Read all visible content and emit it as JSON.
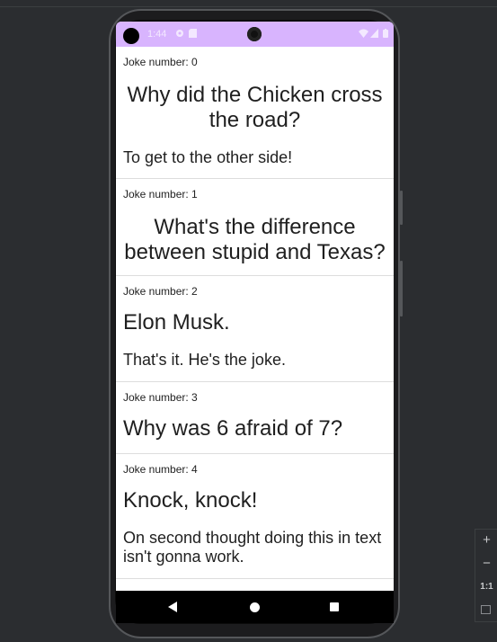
{
  "status_bar": {
    "time": "1:44"
  },
  "jokes": [
    {
      "number_label": "Joke number: 0",
      "question": "Why did the Chicken cross the road?",
      "answer": "To get to the other side!"
    },
    {
      "number_label": "Joke number: 1",
      "question": "What's the difference between stupid and Texas?",
      "answer": ""
    },
    {
      "number_label": "Joke number: 2",
      "question": "Elon Musk.",
      "answer": "That's it. He's the joke."
    },
    {
      "number_label": "Joke number: 3",
      "question": "Why was 6 afraid of 7?",
      "answer": ""
    },
    {
      "number_label": "Joke number: 4",
      "question": "Knock, knock!",
      "answer": "On second thought doing this in text isn't gonna work."
    }
  ],
  "zoom_controls": {
    "zoom_in": "+",
    "zoom_out": "−",
    "actual_size": "1:1"
  },
  "colors": {
    "status_bar": "#d8b4fe",
    "ide_background": "#2b2d30"
  }
}
